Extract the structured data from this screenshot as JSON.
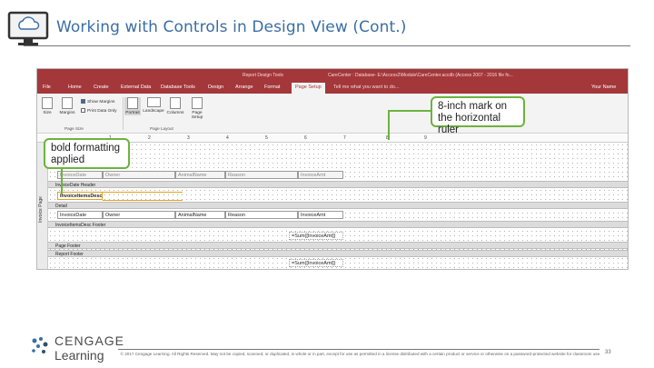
{
  "slide": {
    "title": "Working with Controls in Design View (Cont.)",
    "page_number": "33",
    "copyright": "© 2017 Cengage Learning. All Rights Reserved. May not be copied, scanned, or duplicated, in whole or in part, except for use as permitted in a license distributed with a certain product or service or otherwise on a password-protected website for classroom use.",
    "logo": {
      "line1": "CENGAGE",
      "line2": "Learning"
    }
  },
  "callouts": {
    "ruler_mark": "8-inch mark on the horizontal ruler",
    "bold": "bold formatting applied"
  },
  "window": {
    "context_tab": "Report Design Tools",
    "title": "CareCenter : Database- E:\\Access2\\Module\\CareCenter.accdb (Access 2007 - 2016 file fo...",
    "tell_me": "Tell me what you want to do...",
    "user": "Your Name",
    "tabs": [
      {
        "label": "File"
      },
      {
        "label": "Home"
      },
      {
        "label": "Create"
      },
      {
        "label": "External Data"
      },
      {
        "label": "Database Tools"
      },
      {
        "label": "Design"
      },
      {
        "label": "Arrange"
      },
      {
        "label": "Format"
      },
      {
        "label": "Page Setup"
      }
    ],
    "active_tab": "Page Setup"
  },
  "ribbon": {
    "size": "Size",
    "margins": "Margins",
    "show_margins": "Show Margins",
    "print_data_only": "Print Data Only",
    "portrait": "Portrait",
    "landscape": "Landscape",
    "columns": "Columns",
    "page_setup": "Page Setup",
    "group_page_size": "Page Size",
    "group_page_layout": "Page Layout"
  },
  "ruler": {
    "numbers": [
      "1",
      "2",
      "3",
      "4",
      "5",
      "6",
      "7",
      "8",
      "9"
    ]
  },
  "report": {
    "vertical_label": "Invoice Page",
    "bands": {
      "header": "InvoiceDate Header",
      "detail_header": "InvoiceItemsDesc Header",
      "detail": "Detail",
      "footer": "InvoiceItemsDesc Footer",
      "page_footer": "Page Footer",
      "report_footer": "Report Footer"
    },
    "header_labels": [
      "InvoiceDate",
      "Owner",
      "AnimalName",
      "Reason",
      "InvoiceAmt"
    ],
    "group_field": "InvoiceItemsDesc",
    "detail_fields": [
      "InvoiceDate",
      "Owner",
      "AnimalName",
      "Reason",
      "InvoiceAmt"
    ],
    "sum_1": "=Sum([InvoiceAmt])",
    "sum_2": "=Sum([InvoiceAmt])"
  },
  "colors": {
    "title": "#3a6ea5",
    "access_red": "#a4373a",
    "callout_green": "#6db33f",
    "bold_highlight": "#e3a21a"
  }
}
